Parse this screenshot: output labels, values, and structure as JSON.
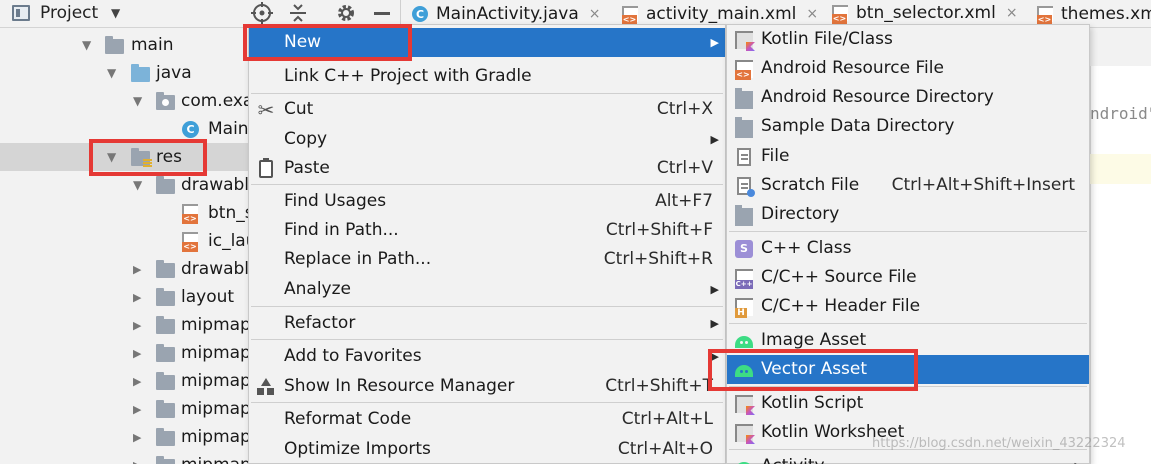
{
  "toolbar": {
    "project_label": "Project"
  },
  "tabs": [
    {
      "label": "MainActivity.java",
      "icon": "java-class-icon",
      "close": "×"
    },
    {
      "label": "activity_main.xml",
      "icon": "xml-file-icon",
      "close": "×"
    },
    {
      "label": "btn_selector.xml",
      "icon": "xml-file-icon",
      "close": "×"
    },
    {
      "label": "themes.xm",
      "icon": "xml-file-icon"
    }
  ],
  "tree": {
    "main": "main",
    "java": "java",
    "package": "com.exa",
    "main_class": "Main",
    "res": "res",
    "drawable1": "drawable",
    "btn_file": "btn_s",
    "ic_file": "ic_lau",
    "drawable2": "drawable",
    "layout": "layout",
    "mipmap1": "mipmap",
    "mipmap2": "mipmap",
    "mipmap3": "mipmap",
    "mipmap4": "mipmap",
    "mipmap5": "mipmap",
    "mipmap6": "mipmap"
  },
  "editor": {
    "snippet": "ndroid\""
  },
  "context_menu": {
    "items": [
      {
        "label": "New",
        "has_submenu": true
      },
      {
        "label": "Link C++ Project with Gradle"
      },
      {
        "label": "Cut",
        "shortcut": "Ctrl+X",
        "icon": "scissors-icon"
      },
      {
        "label": "Copy",
        "has_submenu": true
      },
      {
        "label": "Paste",
        "shortcut": "Ctrl+V",
        "icon": "clipboard-icon"
      },
      {
        "label": "Find Usages",
        "shortcut": "Alt+F7"
      },
      {
        "label": "Find in Path...",
        "shortcut": "Ctrl+Shift+F"
      },
      {
        "label": "Replace in Path...",
        "shortcut": "Ctrl+Shift+R"
      },
      {
        "label": "Analyze",
        "has_submenu": true
      },
      {
        "label": "Refactor",
        "has_submenu": true
      },
      {
        "label": "Add to Favorites",
        "has_submenu": true
      },
      {
        "label": "Show In Resource Manager",
        "shortcut": "Ctrl+Shift+T",
        "icon": "resource-manager-icon"
      },
      {
        "label": "Reformat Code",
        "shortcut": "Ctrl+Alt+L"
      },
      {
        "label": "Optimize Imports",
        "shortcut": "Ctrl+Alt+O"
      }
    ]
  },
  "new_submenu": {
    "items": [
      {
        "label": "Kotlin File/Class",
        "icon": "kotlin-file-icon"
      },
      {
        "label": "Android Resource File",
        "icon": "android-resource-file-icon"
      },
      {
        "label": "Android Resource Directory",
        "icon": "folder-icon"
      },
      {
        "label": "Sample Data Directory",
        "icon": "folder-icon"
      },
      {
        "label": "File",
        "icon": "file-icon"
      },
      {
        "label": "Scratch File",
        "shortcut": "Ctrl+Alt+Shift+Insert",
        "icon": "scratch-file-icon"
      },
      {
        "label": "Directory",
        "icon": "folder-icon"
      },
      {
        "label": "C++ Class",
        "icon": "cpp-class-icon",
        "icon_text": "S"
      },
      {
        "label": "C/C++ Source File",
        "icon": "cpp-source-icon"
      },
      {
        "label": "C/C++ Header File",
        "icon": "cpp-header-icon"
      },
      {
        "label": "Image Asset",
        "icon": "android-icon"
      },
      {
        "label": "Vector Asset",
        "icon": "android-icon"
      },
      {
        "label": "Kotlin Script",
        "icon": "kotlin-script-icon"
      },
      {
        "label": "Kotlin Worksheet",
        "icon": "kotlin-worksheet-icon"
      },
      {
        "label": "Activity",
        "icon": "android-icon",
        "has_submenu": true
      }
    ]
  },
  "watermark": "https://blog.csdn.net/weixin_43222324",
  "colors": {
    "highlight": "#2675c8",
    "annotation_red": "#e53935",
    "android_green": "#3ddc84"
  }
}
